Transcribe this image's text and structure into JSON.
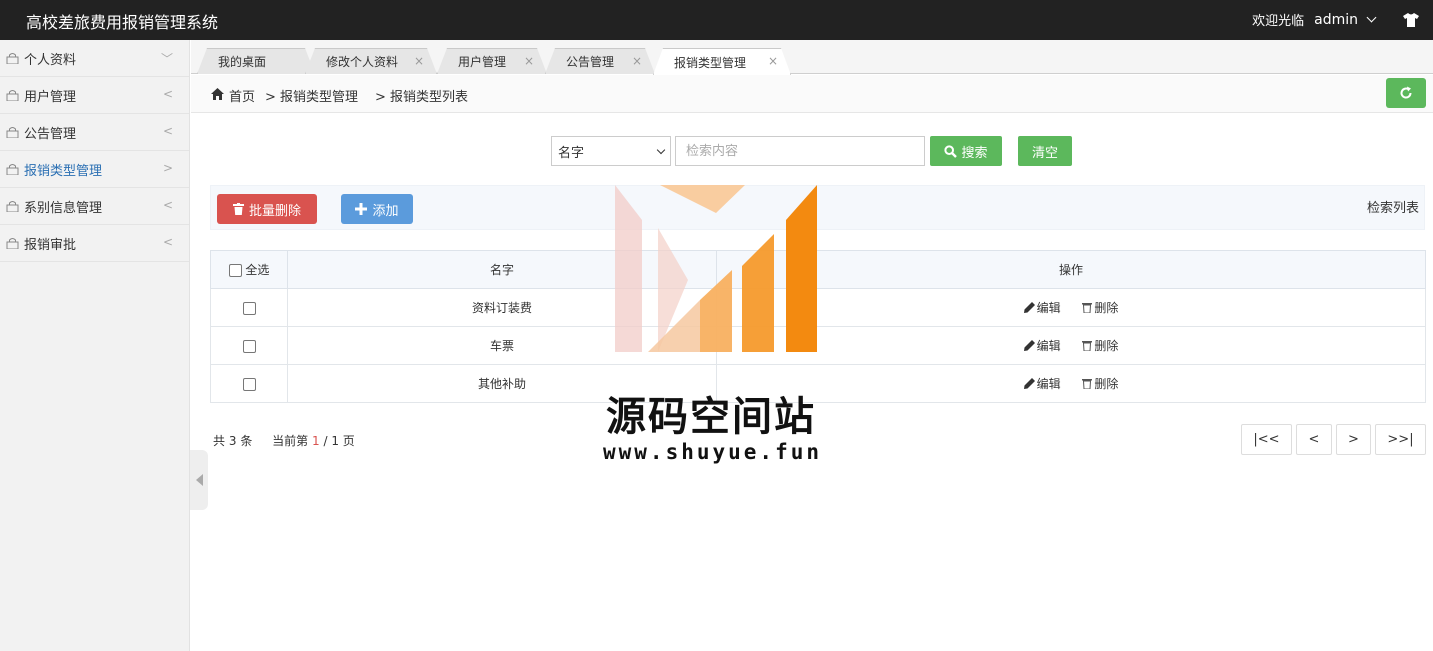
{
  "header": {
    "title": "高校差旅费用报销管理系统",
    "welcome": "欢迎光临",
    "username": "admin"
  },
  "sidebar": {
    "items": [
      {
        "label": "个人资料",
        "arrow": "﹀"
      },
      {
        "label": "用户管理",
        "arrow": "<"
      },
      {
        "label": "公告管理",
        "arrow": "<"
      },
      {
        "label": "报销类型管理",
        "arrow": ">"
      },
      {
        "label": "系别信息管理",
        "arrow": "<"
      },
      {
        "label": "报销审批",
        "arrow": "<"
      }
    ]
  },
  "tabs": [
    {
      "label": "我的桌面"
    },
    {
      "label": "修改个人资料"
    },
    {
      "label": "用户管理"
    },
    {
      "label": "公告管理"
    },
    {
      "label": "报销类型管理"
    }
  ],
  "breadcrumb": {
    "home": "首页",
    "level1": "> 报销类型管理",
    "level2": "> 报销类型列表"
  },
  "search": {
    "field_selected": "名字",
    "placeholder": "检索内容",
    "search_label": "搜索",
    "clear_label": "清空"
  },
  "actions": {
    "batch_delete": "批量删除",
    "add": "添加",
    "list_caption": "检索列表"
  },
  "table": {
    "select_all": "全选",
    "col_name": "名字",
    "col_ops": "操作",
    "edit_label": "编辑",
    "delete_label": "删除",
    "rows": [
      {
        "name": "资料订装费"
      },
      {
        "name": "车票"
      },
      {
        "name": "其他补助"
      }
    ]
  },
  "pager": {
    "total_prefix": "共",
    "total": "3",
    "total_suffix": "条",
    "current_label": "当前第",
    "current": "1",
    "of": "/ 1 页",
    "first": "|<<",
    "prev": "<",
    "next": ">",
    "last": ">>|"
  },
  "watermark": {
    "title": "源码空间站",
    "url": "www.shuyue.fun"
  }
}
